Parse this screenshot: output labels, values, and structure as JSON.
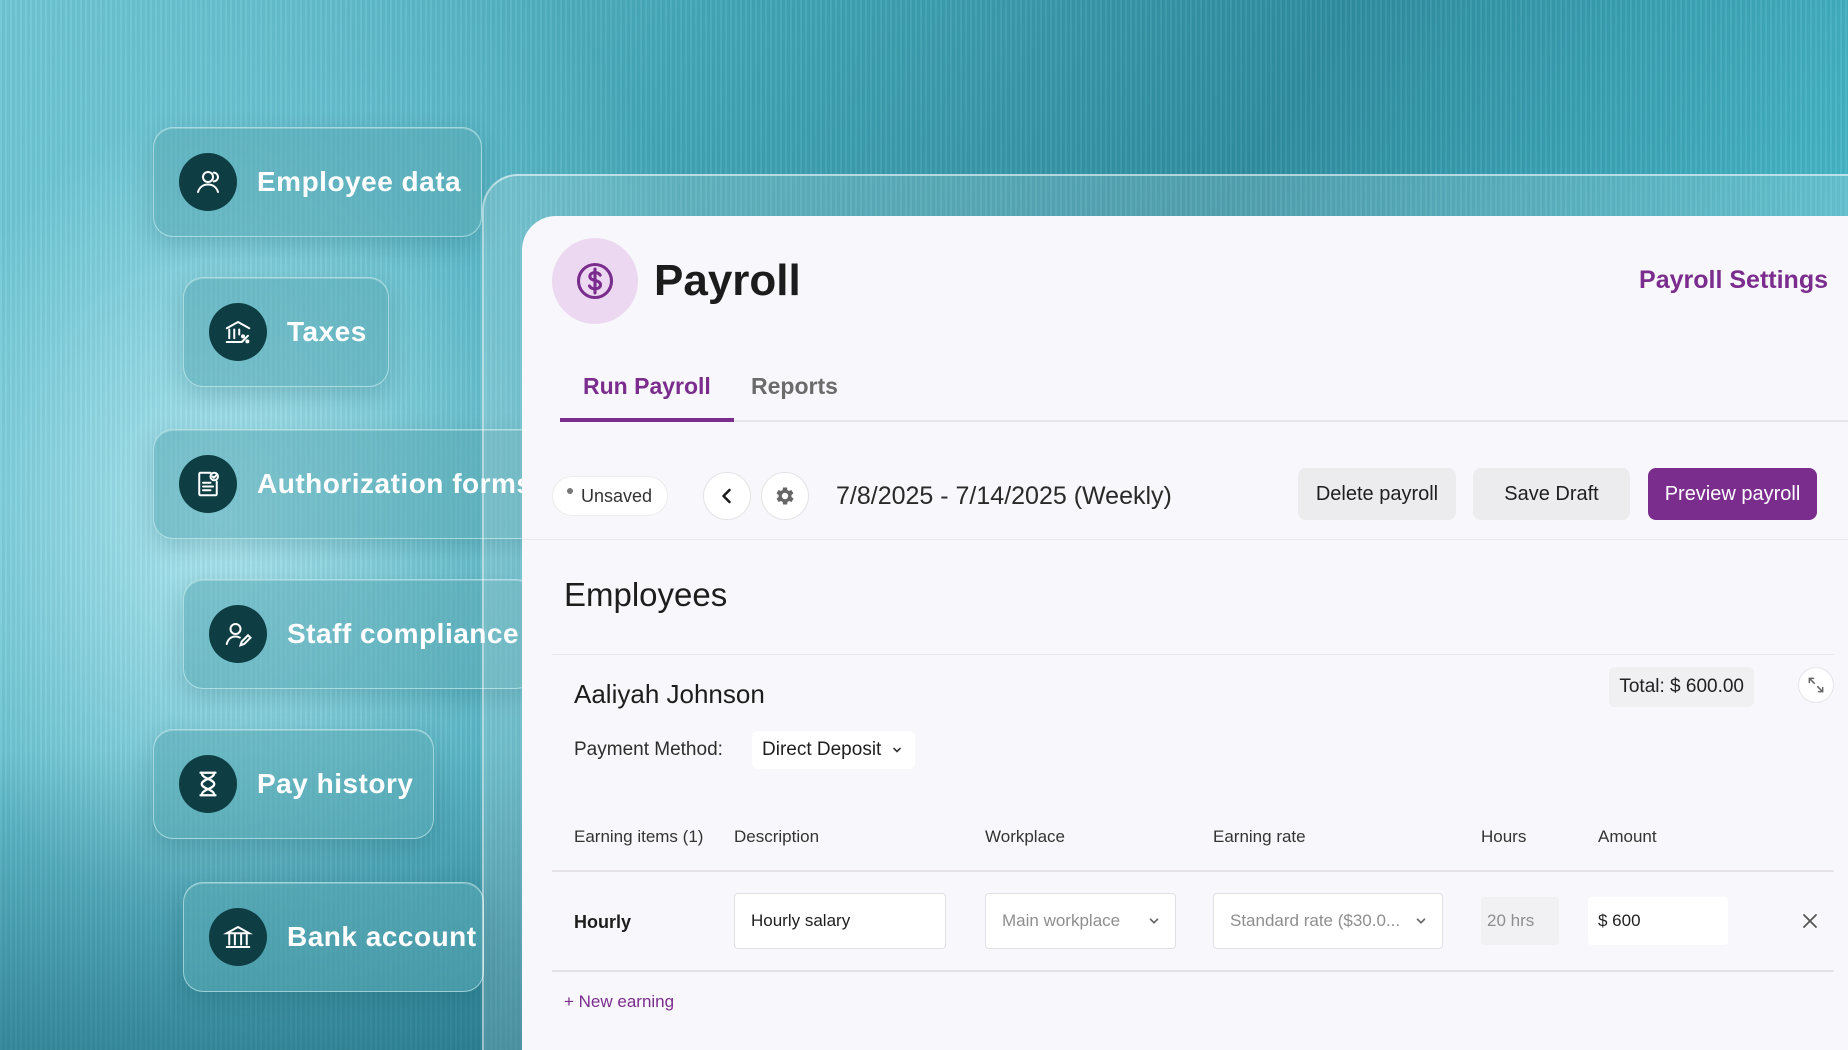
{
  "features": [
    {
      "label": "Employee data",
      "icon": "user-icon"
    },
    {
      "label": "Taxes",
      "icon": "bank-percent-icon"
    },
    {
      "label": "Authorization forms",
      "icon": "document-check-icon"
    },
    {
      "label": "Staff compliance",
      "icon": "user-edit-icon"
    },
    {
      "label": "Pay history",
      "icon": "hourglass-icon"
    },
    {
      "label": "Bank account",
      "icon": "bank-icon"
    }
  ],
  "payroll": {
    "title": "Payroll",
    "settings_label": "Payroll Settings",
    "tabs": [
      {
        "label": "Run Payroll",
        "active": true
      },
      {
        "label": "Reports",
        "active": false
      }
    ],
    "status": "Unsaved",
    "period": "7/8/2025 - 7/14/2025 (Weekly)",
    "actions": {
      "delete": "Delete payroll",
      "save": "Save Draft",
      "preview": "Preview payroll"
    }
  },
  "employees": {
    "title": "Employees",
    "employee": {
      "name": "Aaliyah Johnson",
      "total": "Total: $ 600.00",
      "payment_method_label": "Payment Method:",
      "payment_method": "Direct Deposit",
      "columns": [
        "Earning items (1)",
        "Description",
        "Workplace",
        "Earning rate",
        "Hours",
        "Amount"
      ],
      "earning": {
        "type": "Hourly",
        "description": "Hourly salary",
        "workplace": "Main workplace",
        "rate": "Standard rate ($30.0...",
        "hours": "20 hrs",
        "amount": "$ 600"
      },
      "new_earning": "+ New earning"
    }
  },
  "colors": {
    "accent": "#7b2d8e",
    "icon_bg": "#0e3e44",
    "logo_bg": "#ecd9f1"
  }
}
